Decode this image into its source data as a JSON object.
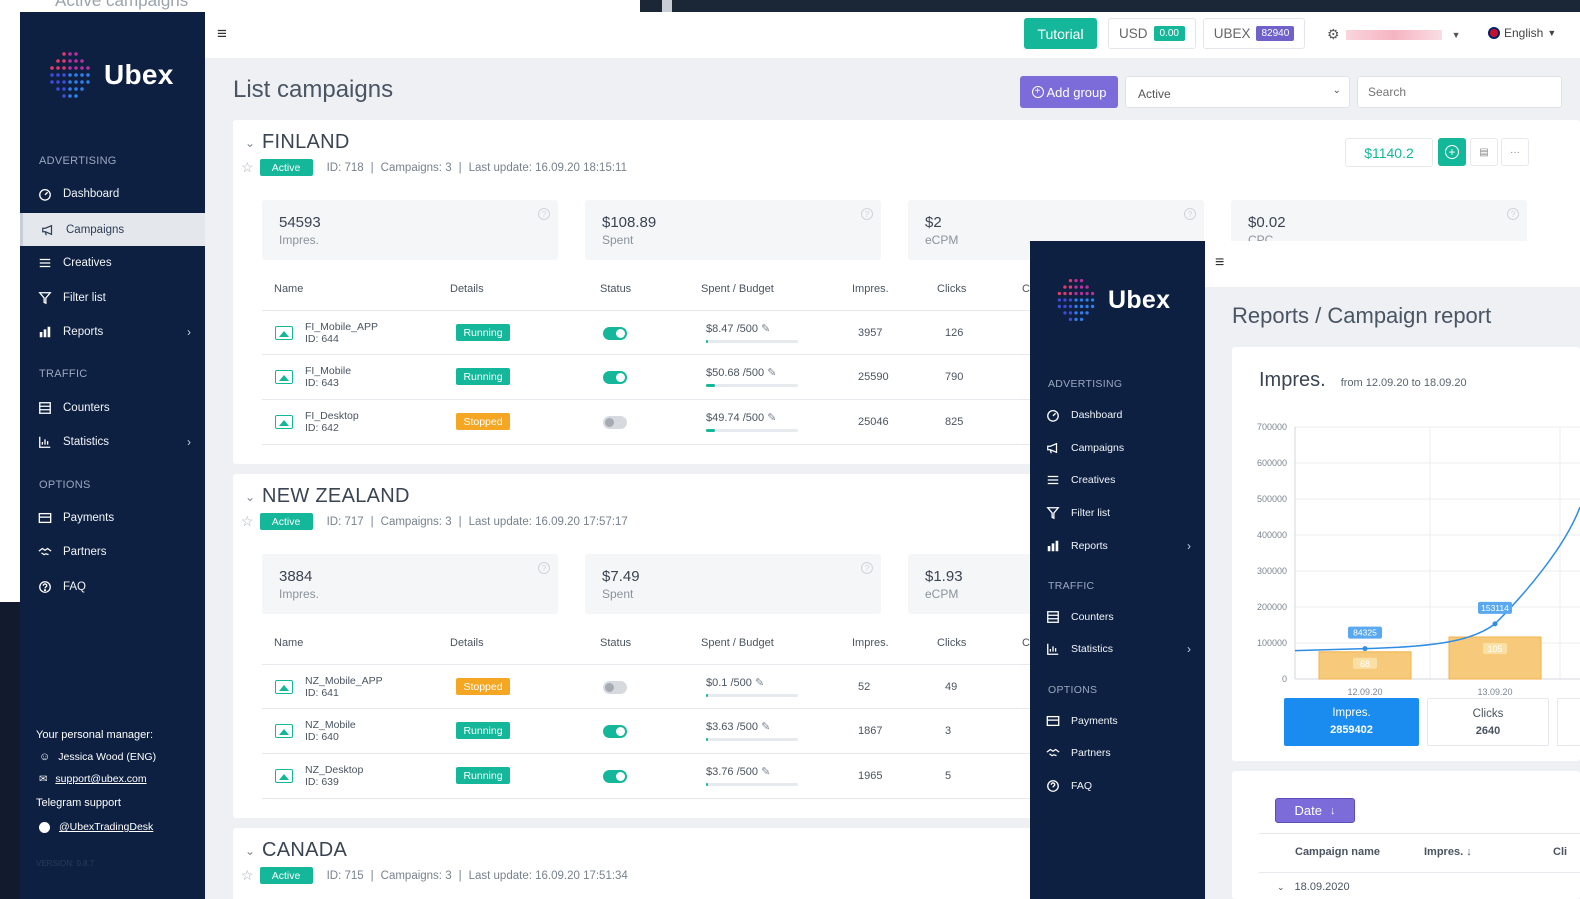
{
  "page": {
    "title": "List campaigns",
    "bg_heading": "Active campaigns"
  },
  "brand": {
    "name": "Ubex"
  },
  "sidebar": {
    "sections": [
      {
        "title": "ADVERTISING",
        "items": [
          {
            "label": "Dashboard",
            "icon": "dashboard-icon"
          },
          {
            "label": "Campaigns",
            "icon": "megaphone-icon",
            "active": true
          },
          {
            "label": "Creatives",
            "icon": "list-icon"
          },
          {
            "label": "Filter list",
            "icon": "filter-icon"
          },
          {
            "label": "Reports",
            "icon": "reports-icon",
            "arrow": true
          }
        ]
      },
      {
        "title": "TRAFFIC",
        "items": [
          {
            "label": "Counters",
            "icon": "counter-icon"
          },
          {
            "label": "Statistics",
            "icon": "bar-chart-icon",
            "arrow": true
          }
        ]
      },
      {
        "title": "OPTIONS",
        "items": [
          {
            "label": "Payments",
            "icon": "card-icon"
          },
          {
            "label": "Partners",
            "icon": "handshake-icon"
          },
          {
            "label": "FAQ",
            "icon": "help-icon"
          }
        ]
      }
    ],
    "manager": {
      "title": "Your personal manager:",
      "name": "Jessica Wood (ENG)",
      "email": "support@ubex.com",
      "telegram_title": "Telegram support",
      "telegram": "@UbexTradingDesk",
      "version": "VERSION: 0.8.7"
    }
  },
  "topbar": {
    "tutorial": "Tutorial",
    "usd_label": "USD",
    "usd_value": "0.00",
    "ubex_label": "UBEX",
    "ubex_value": "82940",
    "language": "English"
  },
  "toolbar": {
    "add_group": "Add group",
    "filter_value": "Active",
    "search_placeholder": "Search"
  },
  "groups": [
    {
      "name": "FINLAND",
      "status": "Active",
      "id": "ID: 718",
      "campaigns": "Campaigns: 3",
      "last_update": "Last update: 16.09.20 18:15:11",
      "balance": "$1140.2",
      "stats": [
        {
          "value": "54593",
          "label": "Impres."
        },
        {
          "value": "$108.89",
          "label": "Spent"
        },
        {
          "value": "$2",
          "label": "eCPM"
        },
        {
          "value": "$0.02",
          "label": "CPC"
        }
      ],
      "rows": [
        {
          "name": "FI_Mobile_APP",
          "id": "ID: 644",
          "status": "Running",
          "on": true,
          "spent": "$8.47 /500",
          "progress": 0.017,
          "impres": "3957",
          "clicks": "126"
        },
        {
          "name": "FI_Mobile",
          "id": "ID: 643",
          "status": "Running",
          "on": true,
          "spent": "$50.68 /500",
          "progress": 0.1,
          "impres": "25590",
          "clicks": "790"
        },
        {
          "name": "FI_Desktop",
          "id": "ID: 642",
          "status": "Stopped",
          "on": false,
          "spent": "$49.74 /500",
          "progress": 0.1,
          "impres": "25046",
          "clicks": "825"
        }
      ]
    },
    {
      "name": "NEW ZEALAND",
      "status": "Active",
      "id": "ID: 717",
      "campaigns": "Campaigns: 3",
      "last_update": "Last update: 16.09.20 17:57:17",
      "stats": [
        {
          "value": "3884",
          "label": "Impres."
        },
        {
          "value": "$7.49",
          "label": "Spent"
        },
        {
          "value": "$1.93",
          "label": "eCPM"
        }
      ],
      "rows": [
        {
          "name": "NZ_Mobile_APP",
          "id": "ID: 641",
          "status": "Stopped",
          "on": false,
          "spent": "$0.1 /500",
          "progress": 0.002,
          "impres": "52",
          "clicks": "49"
        },
        {
          "name": "NZ_Mobile",
          "id": "ID: 640",
          "status": "Running",
          "on": true,
          "spent": "$3.63 /500",
          "progress": 0.007,
          "impres": "1867",
          "clicks": "3"
        },
        {
          "name": "NZ_Desktop",
          "id": "ID: 639",
          "status": "Running",
          "on": true,
          "spent": "$3.76 /500",
          "progress": 0.008,
          "impres": "1965",
          "clicks": "5"
        }
      ]
    },
    {
      "name": "CANADA",
      "status": "Active",
      "id": "ID: 715",
      "campaigns": "Campaigns: 3",
      "last_update": "Last update: 16.09.20 17:51:34"
    }
  ],
  "table_headers": [
    "Name",
    "Details",
    "Status",
    "Spent / Budget",
    "Impres.",
    "Clicks"
  ],
  "report": {
    "title": "Reports / Campaign report",
    "chart_title": "Impres.",
    "range": "from 12.09.20 to 18.09.20",
    "tab_impres_label": "Impres.",
    "tab_impres_value": "2859402",
    "tab_clicks_label": "Clicks",
    "tab_clicks_value": "2640",
    "date_btn": "Date",
    "th_campaign": "Campaign name",
    "th_impres": "Impres.",
    "th_cli": "Cli",
    "row_date": "18.09.2020"
  },
  "chart_data": {
    "type": "bar",
    "categories": [
      "12.09.20",
      "13.09.20"
    ],
    "series": [
      {
        "name": "Impres.",
        "values": [
          84325,
          153114
        ]
      },
      {
        "name": "Clicks",
        "values": [
          68,
          105
        ]
      }
    ],
    "yticks": [
      0,
      100000,
      200000,
      300000,
      400000,
      500000,
      600000,
      700000
    ],
    "ylim": [
      0,
      700000
    ],
    "colors": {
      "bar": "#f7c97a",
      "line": "#2f8de4"
    }
  },
  "colors": {
    "accent": "#15b79a",
    "purple": "#7b6cd9",
    "orange": "#f5a623",
    "sidebar": "#0e2041",
    "blue": "#1a8cf0"
  }
}
